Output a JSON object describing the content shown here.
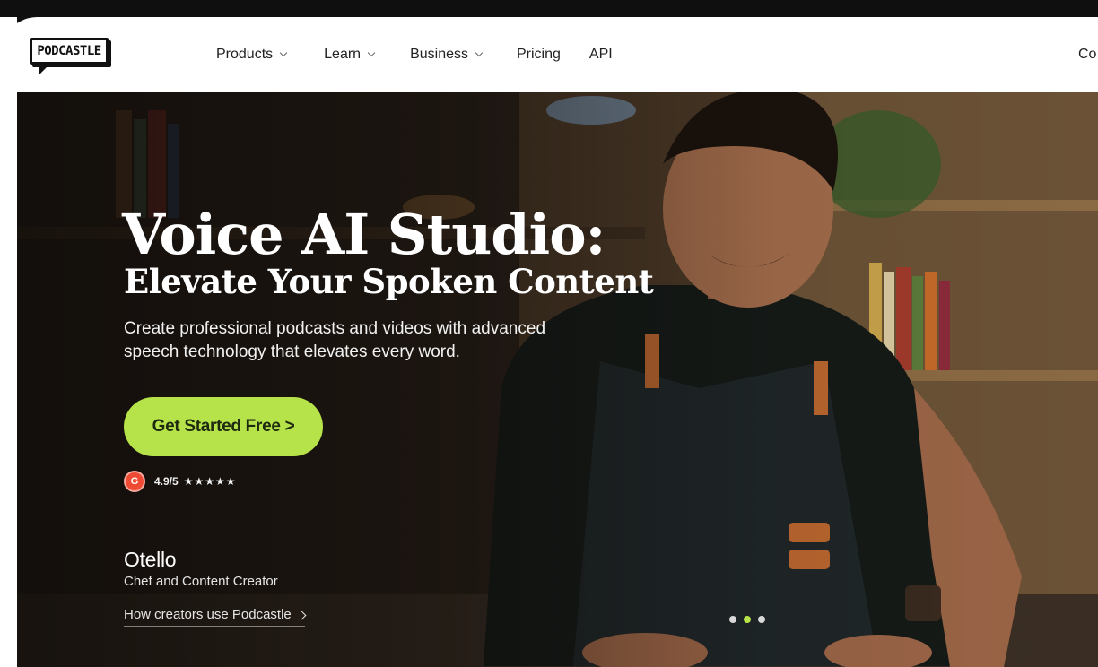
{
  "brand": {
    "logo_text": "PODCASTLE"
  },
  "nav": {
    "items": [
      {
        "label": "Products",
        "has_dropdown": true
      },
      {
        "label": "Learn",
        "has_dropdown": true
      },
      {
        "label": "Business",
        "has_dropdown": true
      },
      {
        "label": "Pricing",
        "has_dropdown": false
      },
      {
        "label": "API",
        "has_dropdown": false
      }
    ],
    "cut_off_label": "Co"
  },
  "hero": {
    "title": "Voice AI Studio:",
    "subtitle": "Elevate Your Spoken Content",
    "description": "Create professional podcasts and videos with advanced speech technology that elevates every word.",
    "cta_label": "Get Started Free >",
    "rating": {
      "badge_text": "G",
      "score": "4.9/5",
      "stars": "★★★★★",
      "star_count": 5
    },
    "creator": {
      "name": "Otello",
      "role": "Chef and Content Creator",
      "link_label": "How creators use Podcastle"
    },
    "carousel": {
      "slides": 3,
      "active_index": 1
    }
  },
  "colors": {
    "accent": "#b6e34a",
    "header_bg": "#ffffff",
    "text_dark": "#222222",
    "g2_red": "#ef4b34"
  }
}
